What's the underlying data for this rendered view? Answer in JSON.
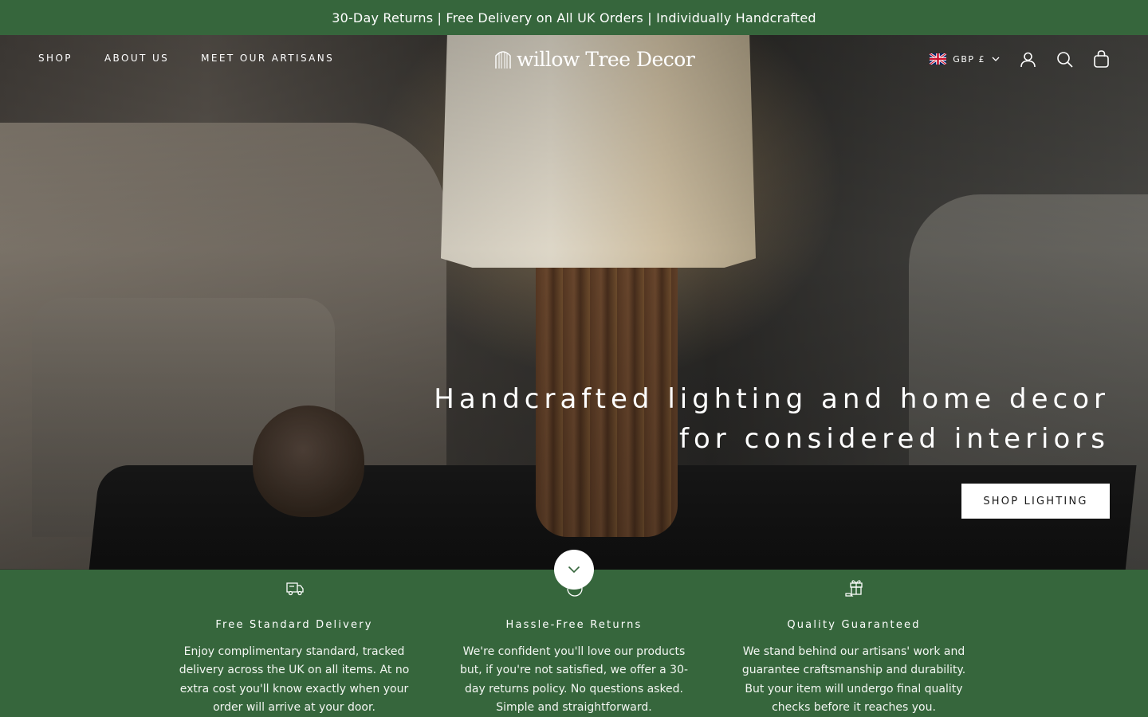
{
  "announcement": {
    "text": "30-Day Returns | Free Delivery on All UK Orders | Individually Handcrafted"
  },
  "header": {
    "nav": [
      {
        "label": "SHOP"
      },
      {
        "label": "ABOUT US"
      },
      {
        "label": "MEET OUR ARTISANS"
      }
    ],
    "logo_text": "willow Tree Decor",
    "currency": {
      "label": "GBP £",
      "flag": "uk-flag-icon"
    },
    "icons": [
      "account-icon",
      "search-icon",
      "cart-icon"
    ]
  },
  "hero": {
    "heading_line1": "Handcrafted lighting and home decor",
    "heading_line2": "for considered interiors",
    "cta_label": "SHOP LIGHTING",
    "scroll_icon": "chevron-down-icon"
  },
  "features": [
    {
      "icon": "delivery-van-icon",
      "title": "Free Standard Delivery",
      "text": "Enjoy complimentary standard, tracked delivery across the UK on all items. At no extra cost you'll know exactly when your order will arrive at your door."
    },
    {
      "icon": "returns-icon",
      "title": "Hassle-Free Returns",
      "text": "We're confident you'll love our products but, if you're not satisfied, we offer a 30-day returns policy. No questions asked. Simple and straightforward."
    },
    {
      "icon": "gift-quality-icon",
      "title": "Quality Guaranteed",
      "text": "We stand behind our artisans' work and guarantee craftsmanship and durability. But your item will undergo final quality checks before it reaches you."
    }
  ],
  "colors": {
    "brand_green": "#36663c",
    "cta_bg": "#ffffff",
    "text_light": "#ffffff"
  }
}
